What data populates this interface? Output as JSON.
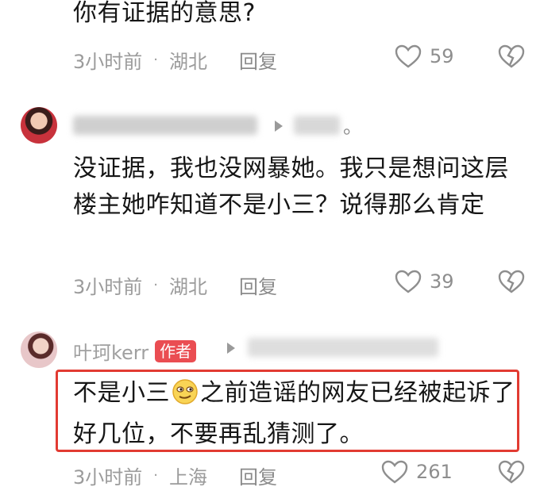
{
  "comment_top": {
    "text": "你有证据的意思?",
    "time": "3小时前",
    "location": "湖北",
    "reply_label": "回复",
    "likes": "59"
  },
  "comment_2": {
    "text": "没证据，我也没网暴她。我只是想问这层楼主她咋知道不是小三？说得那么肯定",
    "time": "3小时前",
    "location": "湖北",
    "reply_label": "回复",
    "likes": "39",
    "suffix": "。"
  },
  "comment_3": {
    "username": "叶珂kerr",
    "author_badge": "作者",
    "text_part1": "不是小三",
    "text_part2": "之前造谣的网友已经被起诉了好几位，不要再乱猜测了。",
    "time": "3小时前",
    "location": "上海",
    "reply_label": "回复",
    "likes": "261"
  },
  "colors": {
    "highlight": "#e23b32",
    "badge": "#ea4d52",
    "meta_text": "#9b9b9b"
  },
  "icons": [
    "heart-outline-icon",
    "broken-heart-icon",
    "play-triangle-icon",
    "smirk-emoji-icon"
  ]
}
